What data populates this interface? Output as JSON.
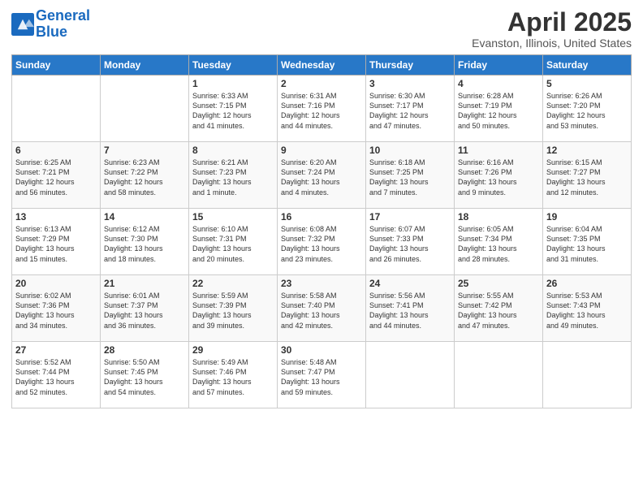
{
  "header": {
    "logo_line1": "General",
    "logo_line2": "Blue",
    "title": "April 2025",
    "subtitle": "Evanston, Illinois, United States"
  },
  "days_of_week": [
    "Sunday",
    "Monday",
    "Tuesday",
    "Wednesday",
    "Thursday",
    "Friday",
    "Saturday"
  ],
  "weeks": [
    [
      {
        "num": "",
        "info": ""
      },
      {
        "num": "",
        "info": ""
      },
      {
        "num": "1",
        "info": "Sunrise: 6:33 AM\nSunset: 7:15 PM\nDaylight: 12 hours\nand 41 minutes."
      },
      {
        "num": "2",
        "info": "Sunrise: 6:31 AM\nSunset: 7:16 PM\nDaylight: 12 hours\nand 44 minutes."
      },
      {
        "num": "3",
        "info": "Sunrise: 6:30 AM\nSunset: 7:17 PM\nDaylight: 12 hours\nand 47 minutes."
      },
      {
        "num": "4",
        "info": "Sunrise: 6:28 AM\nSunset: 7:19 PM\nDaylight: 12 hours\nand 50 minutes."
      },
      {
        "num": "5",
        "info": "Sunrise: 6:26 AM\nSunset: 7:20 PM\nDaylight: 12 hours\nand 53 minutes."
      }
    ],
    [
      {
        "num": "6",
        "info": "Sunrise: 6:25 AM\nSunset: 7:21 PM\nDaylight: 12 hours\nand 56 minutes."
      },
      {
        "num": "7",
        "info": "Sunrise: 6:23 AM\nSunset: 7:22 PM\nDaylight: 12 hours\nand 58 minutes."
      },
      {
        "num": "8",
        "info": "Sunrise: 6:21 AM\nSunset: 7:23 PM\nDaylight: 13 hours\nand 1 minute."
      },
      {
        "num": "9",
        "info": "Sunrise: 6:20 AM\nSunset: 7:24 PM\nDaylight: 13 hours\nand 4 minutes."
      },
      {
        "num": "10",
        "info": "Sunrise: 6:18 AM\nSunset: 7:25 PM\nDaylight: 13 hours\nand 7 minutes."
      },
      {
        "num": "11",
        "info": "Sunrise: 6:16 AM\nSunset: 7:26 PM\nDaylight: 13 hours\nand 9 minutes."
      },
      {
        "num": "12",
        "info": "Sunrise: 6:15 AM\nSunset: 7:27 PM\nDaylight: 13 hours\nand 12 minutes."
      }
    ],
    [
      {
        "num": "13",
        "info": "Sunrise: 6:13 AM\nSunset: 7:29 PM\nDaylight: 13 hours\nand 15 minutes."
      },
      {
        "num": "14",
        "info": "Sunrise: 6:12 AM\nSunset: 7:30 PM\nDaylight: 13 hours\nand 18 minutes."
      },
      {
        "num": "15",
        "info": "Sunrise: 6:10 AM\nSunset: 7:31 PM\nDaylight: 13 hours\nand 20 minutes."
      },
      {
        "num": "16",
        "info": "Sunrise: 6:08 AM\nSunset: 7:32 PM\nDaylight: 13 hours\nand 23 minutes."
      },
      {
        "num": "17",
        "info": "Sunrise: 6:07 AM\nSunset: 7:33 PM\nDaylight: 13 hours\nand 26 minutes."
      },
      {
        "num": "18",
        "info": "Sunrise: 6:05 AM\nSunset: 7:34 PM\nDaylight: 13 hours\nand 28 minutes."
      },
      {
        "num": "19",
        "info": "Sunrise: 6:04 AM\nSunset: 7:35 PM\nDaylight: 13 hours\nand 31 minutes."
      }
    ],
    [
      {
        "num": "20",
        "info": "Sunrise: 6:02 AM\nSunset: 7:36 PM\nDaylight: 13 hours\nand 34 minutes."
      },
      {
        "num": "21",
        "info": "Sunrise: 6:01 AM\nSunset: 7:37 PM\nDaylight: 13 hours\nand 36 minutes."
      },
      {
        "num": "22",
        "info": "Sunrise: 5:59 AM\nSunset: 7:39 PM\nDaylight: 13 hours\nand 39 minutes."
      },
      {
        "num": "23",
        "info": "Sunrise: 5:58 AM\nSunset: 7:40 PM\nDaylight: 13 hours\nand 42 minutes."
      },
      {
        "num": "24",
        "info": "Sunrise: 5:56 AM\nSunset: 7:41 PM\nDaylight: 13 hours\nand 44 minutes."
      },
      {
        "num": "25",
        "info": "Sunrise: 5:55 AM\nSunset: 7:42 PM\nDaylight: 13 hours\nand 47 minutes."
      },
      {
        "num": "26",
        "info": "Sunrise: 5:53 AM\nSunset: 7:43 PM\nDaylight: 13 hours\nand 49 minutes."
      }
    ],
    [
      {
        "num": "27",
        "info": "Sunrise: 5:52 AM\nSunset: 7:44 PM\nDaylight: 13 hours\nand 52 minutes."
      },
      {
        "num": "28",
        "info": "Sunrise: 5:50 AM\nSunset: 7:45 PM\nDaylight: 13 hours\nand 54 minutes."
      },
      {
        "num": "29",
        "info": "Sunrise: 5:49 AM\nSunset: 7:46 PM\nDaylight: 13 hours\nand 57 minutes."
      },
      {
        "num": "30",
        "info": "Sunrise: 5:48 AM\nSunset: 7:47 PM\nDaylight: 13 hours\nand 59 minutes."
      },
      {
        "num": "",
        "info": ""
      },
      {
        "num": "",
        "info": ""
      },
      {
        "num": "",
        "info": ""
      }
    ]
  ]
}
